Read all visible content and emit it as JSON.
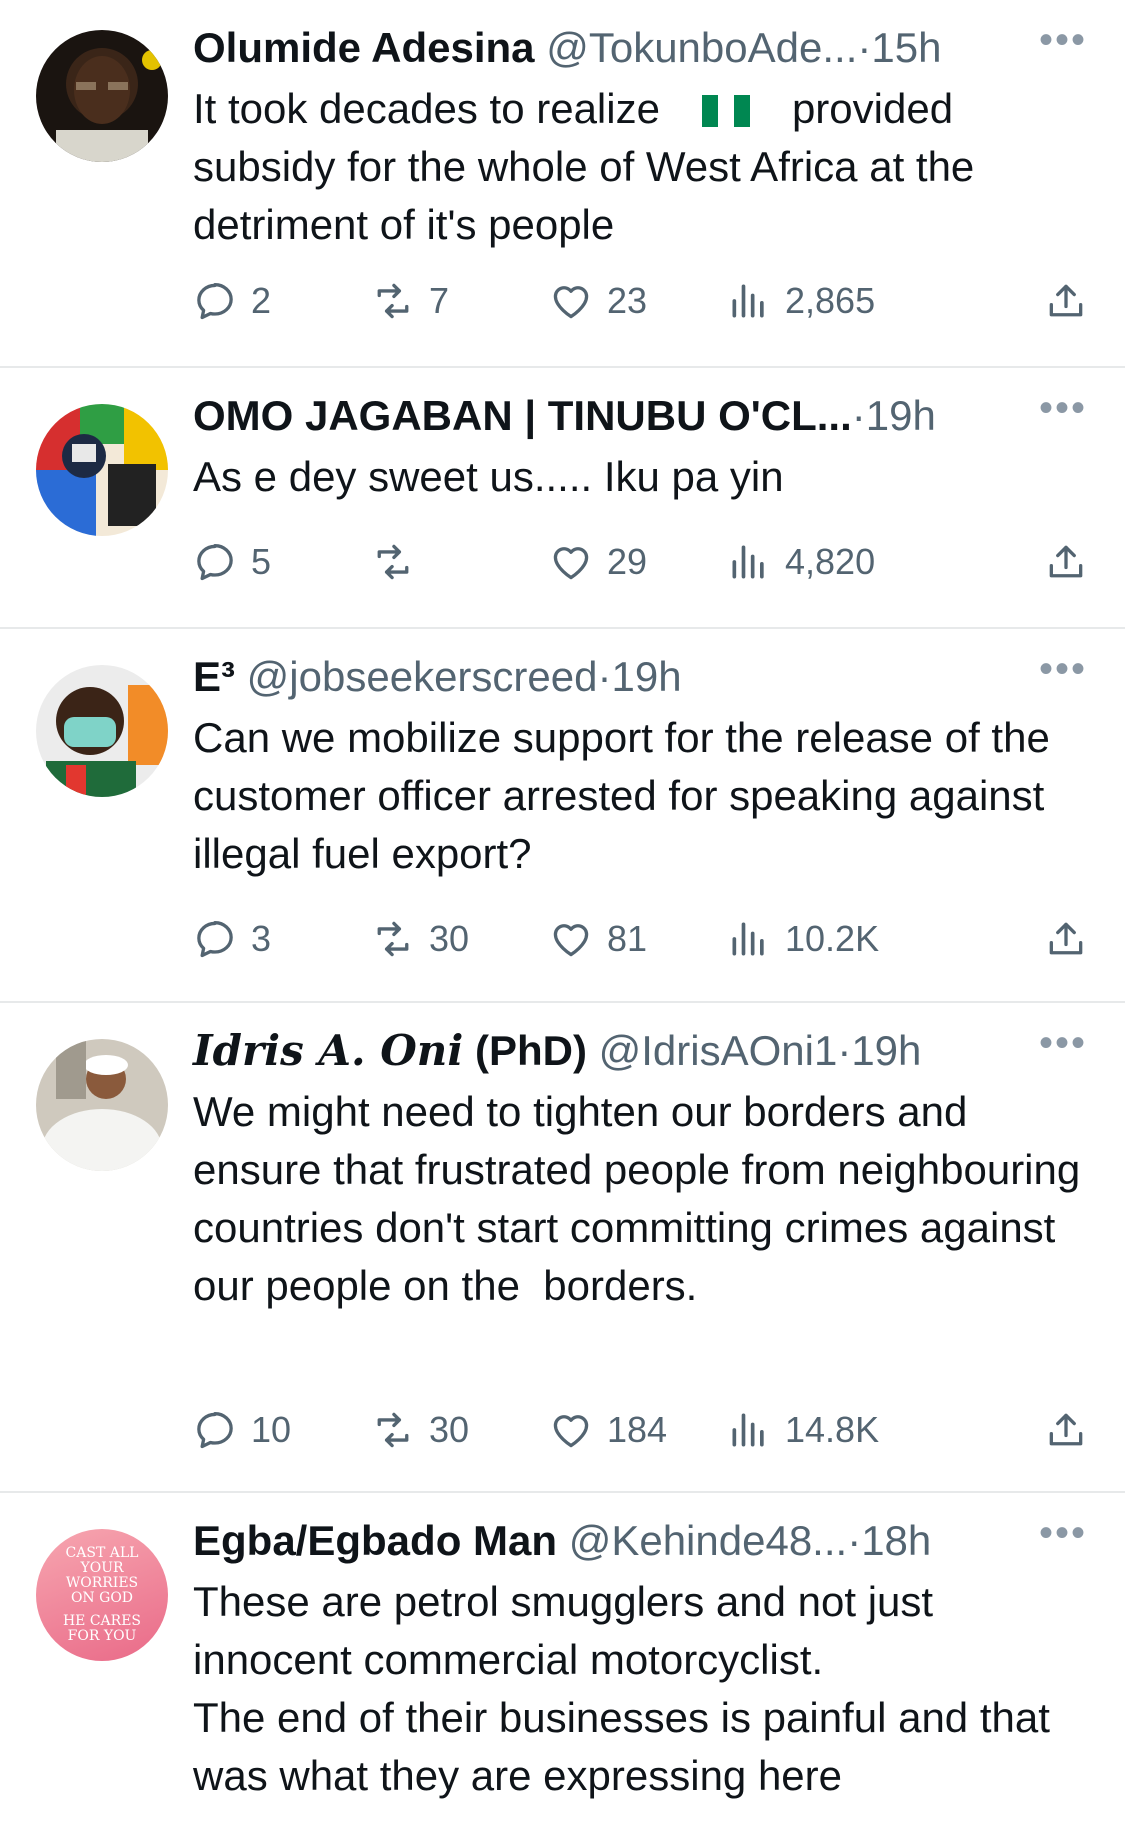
{
  "tweets": [
    {
      "name": "Olumide Adesina",
      "handle": "@TokunboAde...",
      "time": "15h",
      "text_before": "It took decades to realize",
      "text_after": "provided subsidy for the whole of West Africa at the detriment of it's people",
      "replies": "2",
      "retweets": "7",
      "likes": "23",
      "views": "2,865"
    },
    {
      "name": "OMO JAGABAN | TINUBU O'CL...",
      "handle": "",
      "time": "19h",
      "text": "As e dey sweet us..... Iku pa yin",
      "replies": "5",
      "retweets": "",
      "likes": "29",
      "views": "4,820"
    },
    {
      "name": "E³",
      "handle": "@jobseekerscreed",
      "time": "19h",
      "text": "Can we mobilize support for the release of the customer officer arrested for speaking against illegal fuel export?",
      "replies": "3",
      "retweets": "30",
      "likes": "81",
      "views": "10.2K"
    },
    {
      "name_italic": "Idris A. Oni",
      "name": "(PhD)",
      "handle": "@IdrisAOni1",
      "time": "19h",
      "text": "We might need to tighten our borders and ensure that frustrated people from neighbouring countries don't start committing crimes against our people on the  borders.",
      "replies": "10",
      "retweets": "30",
      "likes": "184",
      "views": "14.8K"
    },
    {
      "name": "Egba/Egbado Man",
      "handle": "@Kehinde48...",
      "time": "18h",
      "text": "These are petrol smugglers and not just innocent commercial motorcyclist.\nThe end of their businesses is painful and that was what they are expressing here"
    }
  ],
  "avatar5_text": [
    "CAST ALL",
    "YOUR",
    "WORRIES",
    "ON GOD",
    "HE CARES",
    "FOR YOU"
  ],
  "separator": "·",
  "more": "•••",
  "icons": {
    "reply": "reply-icon",
    "retweet": "retweet-icon",
    "like": "heart-icon",
    "views": "views-icon",
    "share": "share-icon"
  },
  "colors": {
    "text": "#0f1419",
    "muted": "#536471",
    "divider": "#e7e9ea",
    "flag_green": "#008751"
  }
}
